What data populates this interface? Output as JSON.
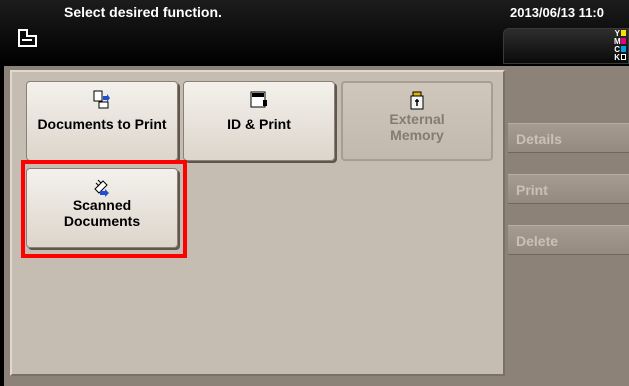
{
  "header": {
    "message": "Select desired function.",
    "datetime": "2013/06/13 11:0",
    "toner": [
      {
        "label": "Y",
        "color": "#f5e400"
      },
      {
        "label": "M",
        "color": "#e6007e"
      },
      {
        "label": "C",
        "color": "#00a0e9"
      },
      {
        "label": "K",
        "color": "#000000"
      }
    ]
  },
  "functions": [
    {
      "label": "Documents to Print",
      "icon": "print-document-icon",
      "enabled": true
    },
    {
      "label": "ID & Print",
      "icon": "id-print-icon",
      "enabled": true
    },
    {
      "label_line1": "External",
      "label_line2": "Memory",
      "icon": "usb-memory-icon",
      "enabled": false
    },
    {
      "label_line1": "Scanned",
      "label_line2": "Documents",
      "icon": "scanned-documents-icon",
      "enabled": true,
      "highlighted": true
    }
  ],
  "side_buttons": {
    "details": "Details",
    "print": "Print",
    "delete": "Delete"
  },
  "colors": {
    "highlight": "#ff0000",
    "panel": "#c6bdb2",
    "background": "#8d8277"
  }
}
